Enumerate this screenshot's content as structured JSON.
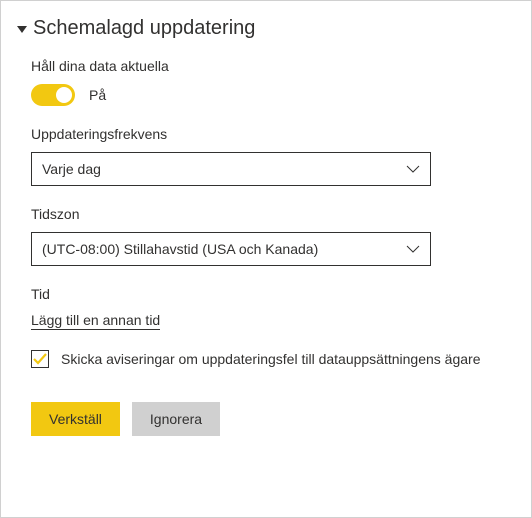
{
  "section": {
    "title": "Schemalagd uppdatering"
  },
  "keepData": {
    "label": "Håll dina data aktuella",
    "state": "På"
  },
  "frequency": {
    "label": "Uppdateringsfrekvens",
    "value": "Varje dag"
  },
  "timezone": {
    "label": "Tidszon",
    "value": "(UTC-08:00) Stillahavstid (USA och Kanada)"
  },
  "time": {
    "label": "Tid",
    "addLink": "Lägg till en annan tid"
  },
  "notify": {
    "label": "Skicka aviseringar om uppdateringsfel till datauppsättningens ägare"
  },
  "buttons": {
    "apply": "Verkställ",
    "discard": "Ignorera"
  },
  "colors": {
    "accent": "#f2c811"
  }
}
